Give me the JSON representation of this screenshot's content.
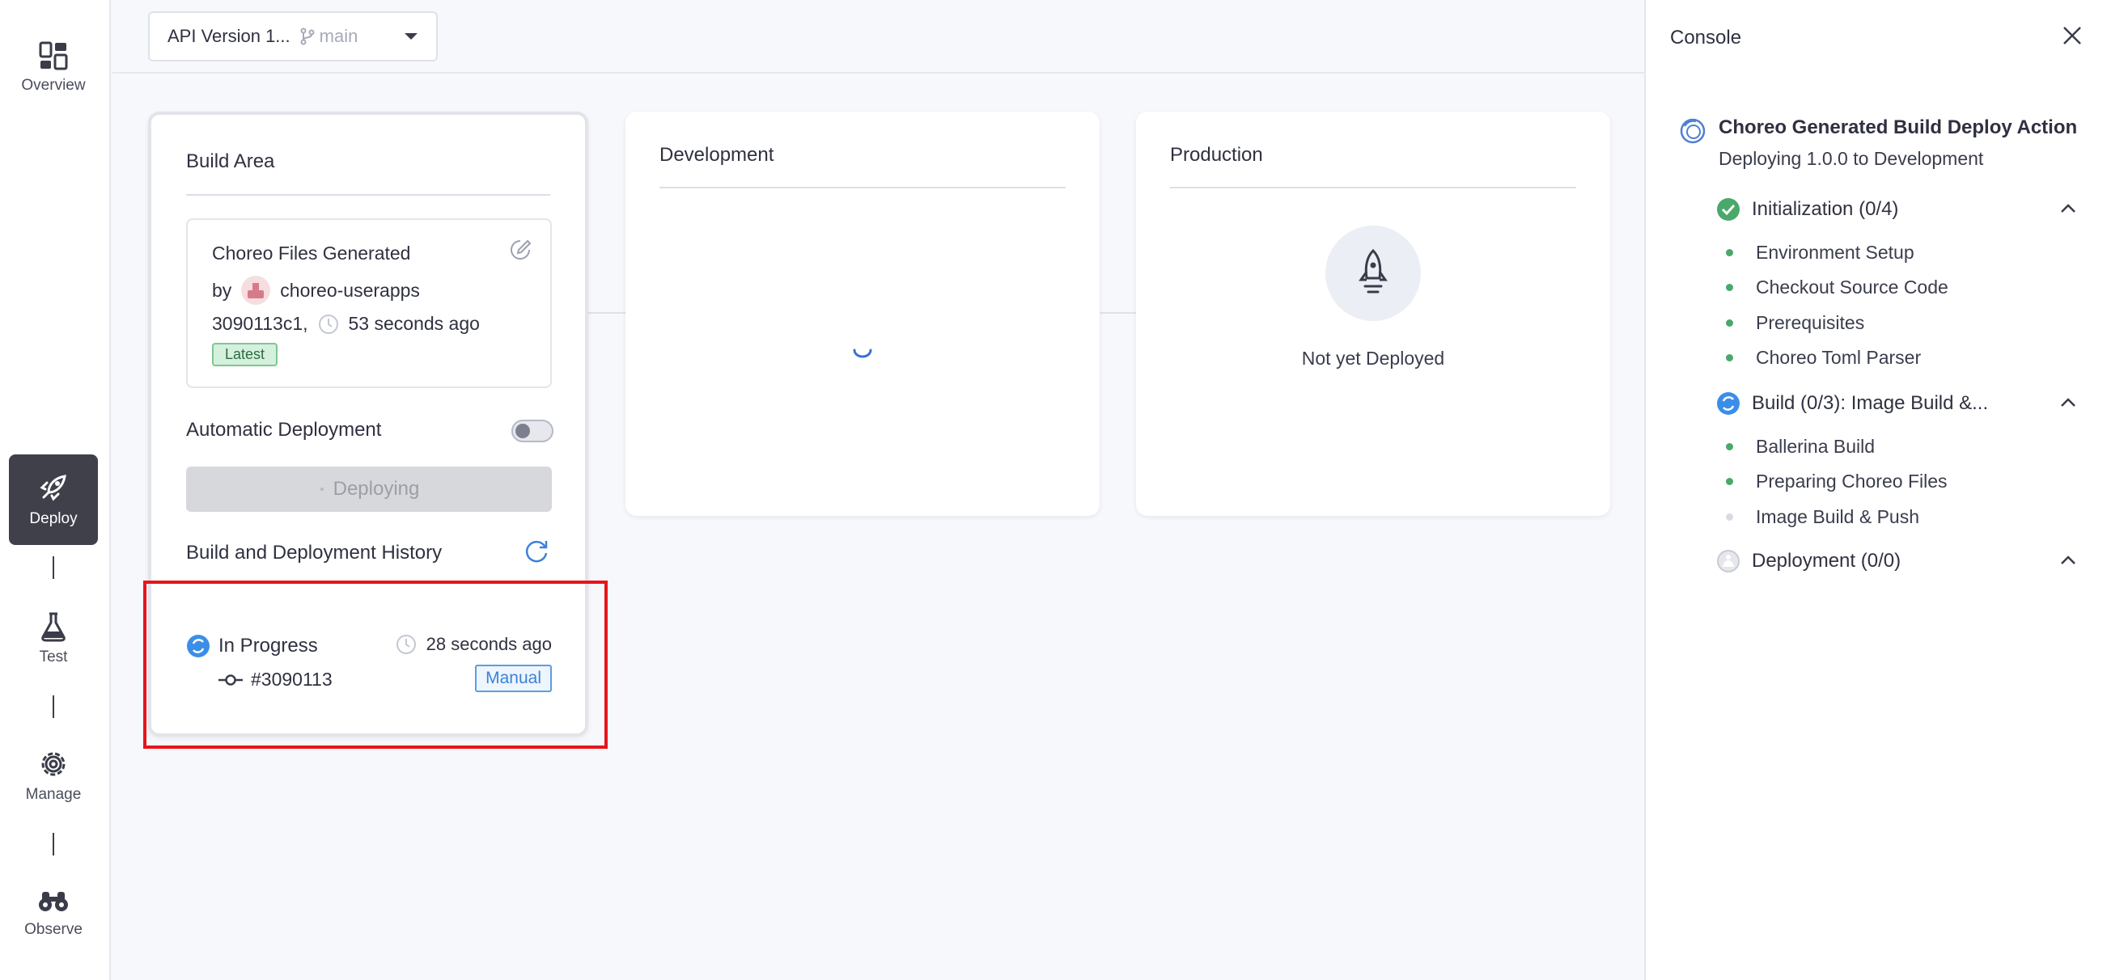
{
  "nav": {
    "items": [
      {
        "label": "Overview",
        "icon": "overview-icon"
      },
      {
        "label": "Deploy",
        "icon": "rocket-icon",
        "active": true
      },
      {
        "label": "Test",
        "icon": "flask-icon"
      },
      {
        "label": "Manage",
        "icon": "gear-icon"
      },
      {
        "label": "Observe",
        "icon": "binoculars-icon"
      }
    ]
  },
  "topbar": {
    "version": "API Version 1...",
    "branch": "main"
  },
  "build_area": {
    "title": "Build Area",
    "commit": {
      "title": "Choreo Files Generated",
      "by_label": "by",
      "author": "choreo-userapps",
      "hash": "3090113c1,",
      "time": "53 seconds ago",
      "badge": "Latest"
    },
    "auto_deploy_label": "Automatic Deployment",
    "auto_deploy_on": false,
    "deploy_button": "Deploying",
    "history_title": "Build and Deployment History",
    "history": [
      {
        "status": "In Progress",
        "time": "28 seconds ago",
        "commit": "#3090113",
        "trigger": "Manual"
      }
    ]
  },
  "environments": [
    {
      "title": "Development",
      "state": "loading"
    },
    {
      "title": "Production",
      "state": "Not yet Deployed"
    }
  ],
  "console": {
    "title": "Console",
    "action_title": "Choreo Generated Build Deploy Action",
    "action_subtitle": "Deploying 1.0.0 to Development",
    "steps": [
      {
        "label": "Initialization (0/4)",
        "status": "done",
        "substeps": [
          "Environment Setup",
          "Checkout Source Code",
          "Prerequisites",
          "Choreo Toml Parser"
        ]
      },
      {
        "label": "Build (0/3):  Image Build &...",
        "status": "running",
        "substeps": [
          "Ballerina Build",
          "Preparing Choreo Files",
          "Image Build & Push"
        ]
      },
      {
        "label": "Deployment (0/0)",
        "status": "pending",
        "substeps": []
      }
    ]
  },
  "colors": {
    "accent": "#3b82d8",
    "success": "#4aa86a",
    "highlight": "#e8141b",
    "nav_active": "#40404b"
  }
}
